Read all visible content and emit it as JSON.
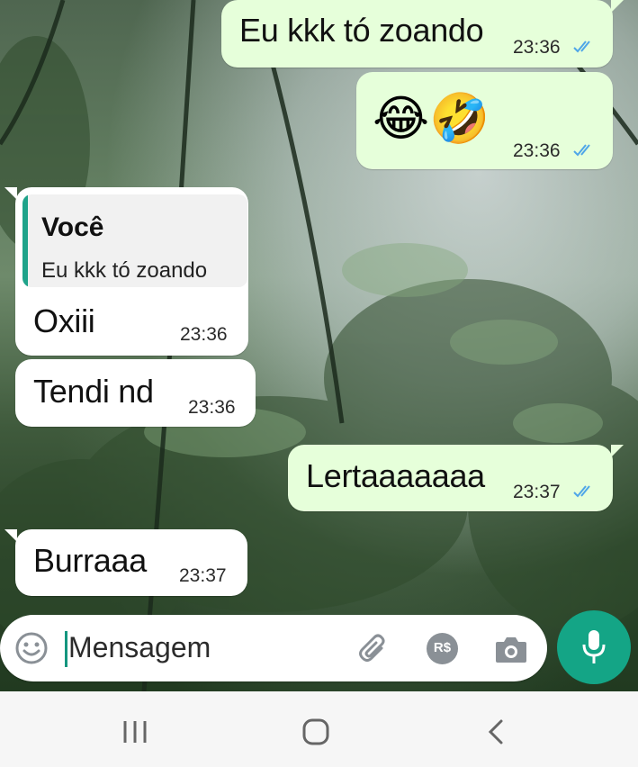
{
  "messages": [
    {
      "text": "Eu kkk tó zoando",
      "time": "23:36",
      "status": "read"
    },
    {
      "emoji": "😂🤣",
      "time": "23:36",
      "status": "read"
    },
    {
      "quote": {
        "author": "Você",
        "text": "Eu kkk tó zoando"
      },
      "text": "Oxiii",
      "time": "23:36"
    },
    {
      "text": "Tendi nd",
      "time": "23:36"
    },
    {
      "text": "Lertaaaaaaa",
      "time": "23:37",
      "status": "read"
    },
    {
      "text": "Burraaa",
      "time": "23:37"
    }
  ],
  "composer": {
    "placeholder": "Mensagem",
    "icons": [
      "emoji-icon",
      "attach-icon",
      "payment-icon",
      "camera-icon",
      "mic-icon"
    ],
    "payment_label": "R$"
  },
  "navbar": {
    "icons": [
      "recent-apps-icon",
      "home-icon",
      "back-icon"
    ]
  },
  "colors": {
    "outgoing_bubble": "#e6ffda",
    "incoming_bubble": "#ffffff",
    "read_ticks": "#4fa6e8",
    "accent": "#14a586",
    "quote_bar": "#1fa38a"
  }
}
